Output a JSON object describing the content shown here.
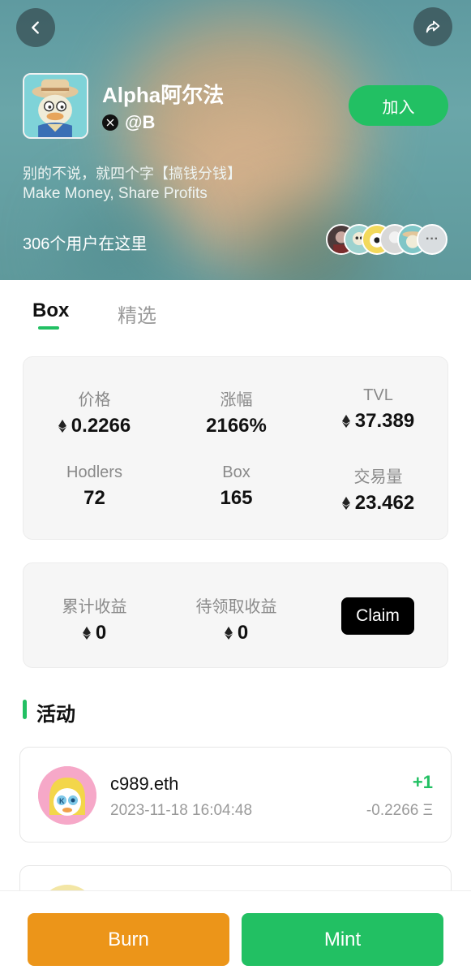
{
  "header": {
    "title": "Alpha阿尔法",
    "handle": "@B",
    "join_label": "加入",
    "description_cn": "别的不说，就四个字【搞钱分钱】",
    "description_en": "Make Money, Share Profits",
    "user_count": "306个用户在这里",
    "more_members": "···"
  },
  "tabs": [
    {
      "label": "Box",
      "active": true
    },
    {
      "label": "精选",
      "active": false
    }
  ],
  "stats": [
    {
      "label": "价格",
      "value": "0.2266",
      "eth": true
    },
    {
      "label": "涨幅",
      "value": "2166%",
      "eth": false
    },
    {
      "label": "TVL",
      "value": "37.389",
      "eth": true
    },
    {
      "label": "Hodlers",
      "value": "72",
      "eth": false
    },
    {
      "label": "Box",
      "value": "165",
      "eth": false
    },
    {
      "label": "交易量",
      "value": "23.462",
      "eth": true
    }
  ],
  "earnings": {
    "total_label": "累计收益",
    "total_value": "0",
    "pending_label": "待领取收益",
    "pending_value": "0",
    "claim_label": "Claim"
  },
  "activity": {
    "title": "活动",
    "items": [
      {
        "name": "c989.eth",
        "time": "2023-11-18 16:04:48",
        "delta": "+1",
        "amount": "-0.2266 Ξ"
      }
    ]
  },
  "actions": {
    "burn_label": "Burn",
    "mint_label": "Mint"
  },
  "colors": {
    "accent": "#22c063",
    "burn": "#ec9519",
    "claim": "#000000"
  }
}
